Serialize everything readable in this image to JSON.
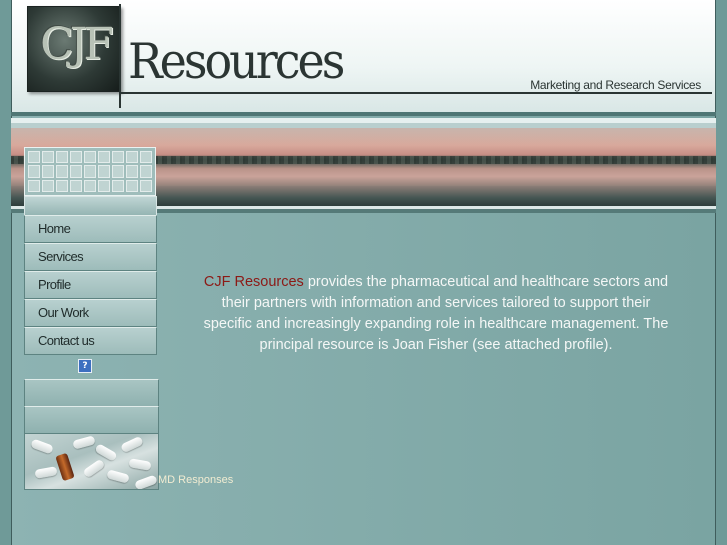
{
  "header": {
    "logo_initials": "CJF",
    "brand": "Resources",
    "tagline": "Marketing and Research Services"
  },
  "nav": {
    "items": [
      {
        "label": "Home"
      },
      {
        "label": "Services"
      },
      {
        "label": "Profile"
      },
      {
        "label": "Our Work"
      },
      {
        "label": "Contact us"
      }
    ],
    "help_icon": "question-mark-icon",
    "help_label": "?"
  },
  "sidebar": {
    "link_label": "MD Responses"
  },
  "main": {
    "company_name": "CJF Resources",
    "intro_text": " provides the pharmaceutical and healthcare sectors and their partners with information and services tailored to support their specific and increasingly expanding role in healthcare management. The principal resource is Joan Fisher (see attached profile)."
  },
  "colors": {
    "background": "#6f9a98",
    "brand_red": "#8c1a16",
    "text_light": "#f4f7f6"
  }
}
